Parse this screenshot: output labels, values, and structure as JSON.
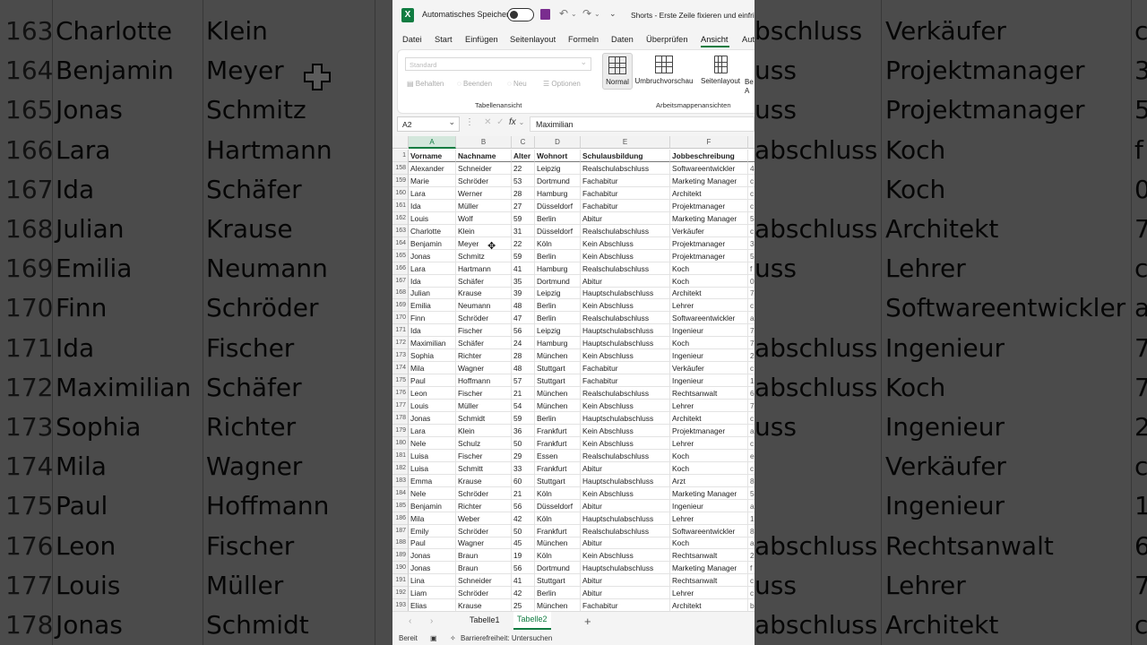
{
  "background": {
    "rows": [
      {
        "num": "163",
        "a": "Charlotte",
        "b": "Klein",
        "r2": "Verkäufer",
        "r1": "bschluss",
        "r3": "c"
      },
      {
        "num": "164",
        "a": "Benjamin",
        "b": "Meyer",
        "r2": "Projektmanager",
        "r1": "uss",
        "r3": "3"
      },
      {
        "num": "165",
        "a": "Jonas",
        "b": "Schmitz",
        "r2": "Projektmanager",
        "r1": "uss",
        "r3": "5"
      },
      {
        "num": "166",
        "a": "Lara",
        "b": "Hartmann",
        "r2": "Koch",
        "r1": "abschluss",
        "r3": "f"
      },
      {
        "num": "167",
        "a": "Ida",
        "b": "Schäfer",
        "r2": "Koch",
        "r1": "",
        "r3": "0"
      },
      {
        "num": "168",
        "a": "Julian",
        "b": "Krause",
        "r2": "Architekt",
        "r1": "abschluss",
        "r3": "7"
      },
      {
        "num": "169",
        "a": "Emilia",
        "b": "Neumann",
        "r2": "Lehrer",
        "r1": "uss",
        "r3": "c"
      },
      {
        "num": "170",
        "a": "Finn",
        "b": "Schröder",
        "r2": "Softwareentwickler",
        "r1": "",
        "r3": "a"
      },
      {
        "num": "171",
        "a": "Ida",
        "b": "Fischer",
        "r2": "Ingenieur",
        "r1": "abschluss",
        "r3": "7"
      },
      {
        "num": "172",
        "a": "Maximilian",
        "b": "Schäfer",
        "r2": "Koch",
        "r1": "abschluss",
        "r3": "7"
      },
      {
        "num": "173",
        "a": "Sophia",
        "b": "Richter",
        "r2": "Ingenieur",
        "r1": "uss",
        "r3": "2"
      },
      {
        "num": "174",
        "a": "Mila",
        "b": "Wagner",
        "r2": "Verkäufer",
        "r1": "",
        "r3": "c"
      },
      {
        "num": "175",
        "a": "Paul",
        "b": "Hoffmann",
        "r2": "Ingenieur",
        "r1": "",
        "r3": "1"
      },
      {
        "num": "176",
        "a": "Leon",
        "b": "Fischer",
        "r2": "Rechtsanwalt",
        "r1": "abschluss",
        "r3": "6"
      },
      {
        "num": "177",
        "a": "Louis",
        "b": "Müller",
        "r2": "Lehrer",
        "r1": "uss",
        "r3": "7"
      },
      {
        "num": "178",
        "a": "Jonas",
        "b": "Schmidt",
        "r2": "Architekt",
        "r1": "abschluss",
        "r3": "c"
      }
    ]
  },
  "titlebar": {
    "autosave_label": "Automatisches Speichern",
    "title": "Shorts - Erste Zeile fixieren und einfrie"
  },
  "menu": {
    "items": [
      "Datei",
      "Start",
      "Einfügen",
      "Seitenlayout",
      "Formeln",
      "Daten",
      "Überprüfen",
      "Ansicht",
      "Aut"
    ],
    "active": "Ansicht"
  },
  "ribbon": {
    "select_placeholder": "Standard",
    "sheet_view_buttons": [
      "Behalten",
      "Beenden",
      "Neu",
      "Optionen"
    ],
    "group_sheet_view": "Tabellenansicht",
    "workbook_view_buttons": [
      "Normal",
      "Umbruchvorschau",
      "Seitenlayout",
      "Be A"
    ],
    "group_workbook_view": "Arbeitsmappenansichten"
  },
  "formula_bar": {
    "name_box": "A2",
    "fx": "fx",
    "value": "Maximilian"
  },
  "sheet": {
    "columns": [
      "A",
      "B",
      "C",
      "D",
      "E",
      "F"
    ],
    "header_row_num": "1",
    "headers": [
      "Vorname",
      "Nachname",
      "Alter",
      "Wohnort",
      "Schulausbildung",
      "Jobbeschreibung",
      ""
    ],
    "rows": [
      {
        "n": "158",
        "c": [
          "Alexander",
          "Schneider",
          "22",
          "Leipzig",
          "Realschulabschluss",
          "Softwareentwickler",
          "4"
        ]
      },
      {
        "n": "159",
        "c": [
          "Marie",
          "Schröder",
          "53",
          "Dortmund",
          "Fachabitur",
          "Marketing Manager",
          "c"
        ]
      },
      {
        "n": "160",
        "c": [
          "Lara",
          "Werner",
          "28",
          "Hamburg",
          "Fachabitur",
          "Architekt",
          "c"
        ]
      },
      {
        "n": "161",
        "c": [
          "Ida",
          "Müller",
          "27",
          "Düsseldorf",
          "Fachabitur",
          "Projektmanager",
          "c"
        ]
      },
      {
        "n": "162",
        "c": [
          "Louis",
          "Wolf",
          "59",
          "Berlin",
          "Abitur",
          "Marketing Manager",
          "5"
        ]
      },
      {
        "n": "163",
        "c": [
          "Charlotte",
          "Klein",
          "31",
          "Düsseldorf",
          "Realschulabschluss",
          "Verkäufer",
          "c"
        ]
      },
      {
        "n": "164",
        "c": [
          "Benjamin",
          "Meyer",
          "22",
          "Köln",
          "Kein Abschluss",
          "Projektmanager",
          "3"
        ]
      },
      {
        "n": "165",
        "c": [
          "Jonas",
          "Schmitz",
          "59",
          "Berlin",
          "Kein Abschluss",
          "Projektmanager",
          "5"
        ]
      },
      {
        "n": "166",
        "c": [
          "Lara",
          "Hartmann",
          "41",
          "Hamburg",
          "Realschulabschluss",
          "Koch",
          "f"
        ]
      },
      {
        "n": "167",
        "c": [
          "Ida",
          "Schäfer",
          "35",
          "Dortmund",
          "Abitur",
          "Koch",
          "0"
        ]
      },
      {
        "n": "168",
        "c": [
          "Julian",
          "Krause",
          "39",
          "Leipzig",
          "Hauptschulabschluss",
          "Architekt",
          "7"
        ]
      },
      {
        "n": "169",
        "c": [
          "Emilia",
          "Neumann",
          "48",
          "Berlin",
          "Kein Abschluss",
          "Lehrer",
          "c"
        ]
      },
      {
        "n": "170",
        "c": [
          "Finn",
          "Schröder",
          "47",
          "Berlin",
          "Realschulabschluss",
          "Softwareentwickler",
          "a"
        ]
      },
      {
        "n": "171",
        "c": [
          "Ida",
          "Fischer",
          "56",
          "Leipzig",
          "Hauptschulabschluss",
          "Ingenieur",
          "7"
        ]
      },
      {
        "n": "172",
        "c": [
          "Maximilian",
          "Schäfer",
          "24",
          "Hamburg",
          "Hauptschulabschluss",
          "Koch",
          "7"
        ]
      },
      {
        "n": "173",
        "c": [
          "Sophia",
          "Richter",
          "28",
          "München",
          "Kein Abschluss",
          "Ingenieur",
          "2"
        ]
      },
      {
        "n": "174",
        "c": [
          "Mila",
          "Wagner",
          "48",
          "Stuttgart",
          "Fachabitur",
          "Verkäufer",
          "c"
        ]
      },
      {
        "n": "175",
        "c": [
          "Paul",
          "Hoffmann",
          "57",
          "Stuttgart",
          "Fachabitur",
          "Ingenieur",
          "1"
        ]
      },
      {
        "n": "176",
        "c": [
          "Leon",
          "Fischer",
          "21",
          "München",
          "Realschulabschluss",
          "Rechtsanwalt",
          "6"
        ]
      },
      {
        "n": "177",
        "c": [
          "Louis",
          "Müller",
          "54",
          "München",
          "Kein Abschluss",
          "Lehrer",
          "7"
        ]
      },
      {
        "n": "178",
        "c": [
          "Jonas",
          "Schmidt",
          "59",
          "Berlin",
          "Hauptschulabschluss",
          "Architekt",
          "c"
        ]
      },
      {
        "n": "179",
        "c": [
          "Lara",
          "Klein",
          "36",
          "Frankfurt",
          "Kein Abschluss",
          "Projektmanager",
          "a"
        ]
      },
      {
        "n": "180",
        "c": [
          "Nele",
          "Schulz",
          "50",
          "Frankfurt",
          "Kein Abschluss",
          "Lehrer",
          "c"
        ]
      },
      {
        "n": "181",
        "c": [
          "Luisa",
          "Fischer",
          "29",
          "Essen",
          "Realschulabschluss",
          "Koch",
          "e"
        ]
      },
      {
        "n": "182",
        "c": [
          "Luisa",
          "Schmitt",
          "33",
          "Frankfurt",
          "Abitur",
          "Koch",
          "c"
        ]
      },
      {
        "n": "183",
        "c": [
          "Emma",
          "Krause",
          "60",
          "Stuttgart",
          "Hauptschulabschluss",
          "Arzt",
          "8"
        ]
      },
      {
        "n": "184",
        "c": [
          "Nele",
          "Schröder",
          "21",
          "Köln",
          "Kein Abschluss",
          "Marketing Manager",
          "5"
        ]
      },
      {
        "n": "185",
        "c": [
          "Benjamin",
          "Richter",
          "56",
          "Düsseldorf",
          "Abitur",
          "Ingenieur",
          "a"
        ]
      },
      {
        "n": "186",
        "c": [
          "Mila",
          "Weber",
          "42",
          "Köln",
          "Hauptschulabschluss",
          "Lehrer",
          "1"
        ]
      },
      {
        "n": "187",
        "c": [
          "Emily",
          "Schröder",
          "50",
          "Frankfurt",
          "Realschulabschluss",
          "Softwareentwickler",
          "8"
        ]
      },
      {
        "n": "188",
        "c": [
          "Paul",
          "Wagner",
          "45",
          "München",
          "Abitur",
          "Koch",
          "a"
        ]
      },
      {
        "n": "189",
        "c": [
          "Jonas",
          "Braun",
          "19",
          "Köln",
          "Kein Abschluss",
          "Rechtsanwalt",
          "2"
        ]
      },
      {
        "n": "190",
        "c": [
          "Jonas",
          "Braun",
          "56",
          "Dortmund",
          "Hauptschulabschluss",
          "Marketing Manager",
          "f"
        ]
      },
      {
        "n": "191",
        "c": [
          "Lina",
          "Schneider",
          "41",
          "Stuttgart",
          "Abitur",
          "Rechtsanwalt",
          "c"
        ]
      },
      {
        "n": "192",
        "c": [
          "Liam",
          "Schröder",
          "42",
          "Berlin",
          "Abitur",
          "Lehrer",
          "c"
        ]
      },
      {
        "n": "193",
        "c": [
          "Elias",
          "Krause",
          "25",
          "München",
          "Fachabitur",
          "Architekt",
          "b"
        ]
      }
    ]
  },
  "tabs": {
    "items": [
      "Tabelle1",
      "Tabelle2"
    ],
    "active": "Tabelle2",
    "add": "+"
  },
  "status": {
    "ready": "Bereit",
    "accessibility": "Barrierefreiheit: Untersuchen"
  },
  "colors": {
    "accent": "#107c41"
  }
}
